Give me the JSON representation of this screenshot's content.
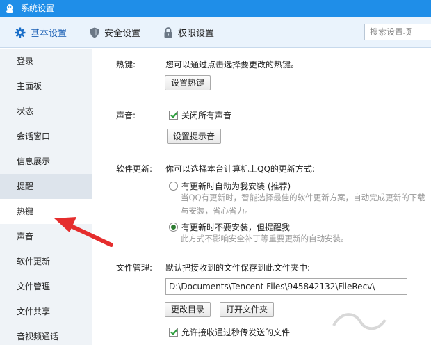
{
  "window": {
    "title": "系统设置"
  },
  "tabs": [
    {
      "label": "基本设置",
      "icon": "gear-icon",
      "active": true
    },
    {
      "label": "安全设置",
      "icon": "shield-icon",
      "active": false
    },
    {
      "label": "权限设置",
      "icon": "lock-icon",
      "active": false
    }
  ],
  "search": {
    "placeholder": "搜索设置项"
  },
  "sidebar": {
    "items": [
      {
        "label": "登录"
      },
      {
        "label": "主面板"
      },
      {
        "label": "状态"
      },
      {
        "label": "会话窗口"
      },
      {
        "label": "信息展示"
      },
      {
        "label": "提醒"
      },
      {
        "label": "热键"
      },
      {
        "label": "声音"
      },
      {
        "label": "软件更新"
      },
      {
        "label": "文件管理"
      },
      {
        "label": "文件共享"
      },
      {
        "label": "音视频通话"
      }
    ],
    "selected": "热键",
    "hovered": "提醒"
  },
  "hotkey": {
    "label": "热键:",
    "desc": "您可以通过点击选择要更改的热键。",
    "button": "设置热键"
  },
  "sound": {
    "label": "声音:",
    "checkbox": "关闭所有声音",
    "checked": true,
    "button": "设置提示音"
  },
  "update": {
    "label": "软件更新:",
    "desc": "你可以选择本台计算机上QQ的更新方式:",
    "option1": "有更新时自动为我安装 (推荐)",
    "option1_hint1": "当QQ有更新时，智能选择最佳的软件更新方案，自动完成更新的下载",
    "option1_hint2": "与安装，省心省力。",
    "option2": "有更新时不要安装，但提醒我",
    "option2_hint": "此方式不影响安全补丁等重要更新的自动安装。",
    "selected_option": 2
  },
  "files": {
    "label": "文件管理:",
    "desc": "默认把接收到的文件保存到此文件夹中:",
    "path": "D:\\Documents\\Tencent Files\\945842132\\FileRecv\\",
    "change_button": "更改目录",
    "open_button": "打开文件夹",
    "allow_checkbox": "允许接收通过秒传发送的文件",
    "allow_checked": true
  },
  "colors": {
    "titlebar": "#1f8ee8",
    "accent": "#1a5fb4",
    "check": "#2e9e3e",
    "arrow": "#e52d2d"
  }
}
